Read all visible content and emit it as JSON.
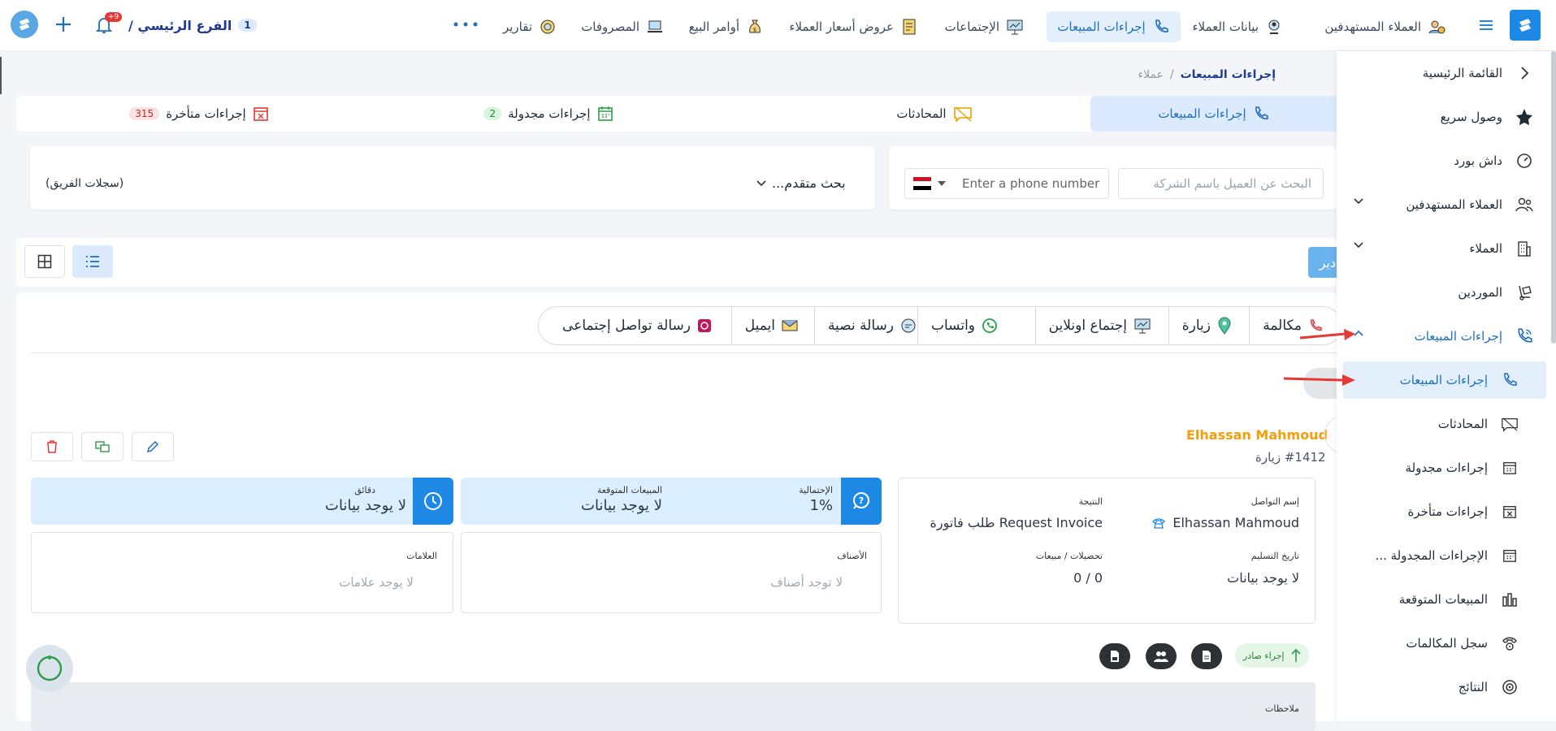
{
  "topbar": {
    "items": [
      {
        "label": "العملاء المستهدفين",
        "icon": "target-customers-icon"
      },
      {
        "label": "بيانات العملاء",
        "icon": "customer-data-icon"
      },
      {
        "label": "إجراءات المبيعات",
        "icon": "phone-icon"
      },
      {
        "label": "الإجتماعات",
        "icon": "presentation-icon"
      },
      {
        "label": "عروض أسعار العملاء",
        "icon": "quote-document-icon"
      },
      {
        "label": "أوامر البيع",
        "icon": "money-bag-icon"
      },
      {
        "label": "المصروفات",
        "icon": "laptop-icon"
      },
      {
        "label": "تقارير",
        "icon": "report-chart-icon"
      }
    ],
    "branch_label": "الفرع الرئيسي /",
    "branch_count": "1",
    "notification_count": "+9"
  },
  "breadcrumb": {
    "parent": "عملاء",
    "separator": "/",
    "current": "إجراءات المبيعات"
  },
  "tabs": [
    {
      "label": "إجراءات المبيعات"
    },
    {
      "label": "المحادثات"
    },
    {
      "label": "إجراءات مجدولة",
      "badge": "2"
    },
    {
      "label": "إجراءات متأخرة",
      "badge": "315"
    }
  ],
  "search": {
    "company_placeholder": "البحث عن العميل باسم الشركة",
    "phone_placeholder": "Enter a phone number",
    "advanced": "بحث متقدم...",
    "team_records": "(سجلات الفريق)"
  },
  "toolbar": {
    "export_partial": "دير"
  },
  "channels": [
    {
      "label": "مكالمة"
    },
    {
      "label": "زيارة"
    },
    {
      "label": "إجتماع اونلاين"
    },
    {
      "label": "واتساب"
    },
    {
      "label": "رسالة نصية"
    },
    {
      "label": "ايميل"
    },
    {
      "label": "رسالة تواصل إجتماعى"
    }
  ],
  "record": {
    "name": "Elhassan Mahmoud",
    "number": "#1412 زيارة",
    "contact_label": "إسم التواصل",
    "contact_value": "Elhassan Mahmoud",
    "result_label": "النتيجة",
    "result_value": "Request Invoice طلب فاتورة",
    "delivery_label": "تاريخ التسليم",
    "delivery_value": "لا يوجد بيانات",
    "collections_label": "تحصيلات / مبيعات",
    "collections_value": "0 / 0",
    "probability_label": "الإحتمالية",
    "probability_value": "1%",
    "expected_label": "المبيعات المتوقعة",
    "expected_value": "لا يوجد بيانات",
    "minutes_label": "دقائق",
    "minutes_value": "لا يوجد بيانات",
    "categories_label": "الأصناف",
    "categories_value": "لا توجد أصناف",
    "tags_label": "العلامات",
    "tags_value": "لا يوجد علامات",
    "direction_badge": "إجراء صادر",
    "notes_label": "ملاحظات"
  },
  "sidebar": {
    "items": [
      {
        "label": "القائمة الرئيسية"
      },
      {
        "label": "وصول سريع"
      },
      {
        "label": "داش بورد"
      },
      {
        "label": "العملاء المستهدفين"
      },
      {
        "label": "العملاء"
      },
      {
        "label": "الموردين"
      },
      {
        "label": "إجراءات المبيعات"
      },
      {
        "label": "إجراءات المبيعات"
      },
      {
        "label": "المحادثات"
      },
      {
        "label": "إجراءات مجدولة"
      },
      {
        "label": "إجراءات متأخرة"
      },
      {
        "label": "الإجراءات المجدولة ..."
      },
      {
        "label": "المبيعات المتوقعة"
      },
      {
        "label": "سجل المكالمات"
      },
      {
        "label": "النتائج"
      }
    ]
  },
  "colors": {
    "accent": "#1e88e5",
    "active_bg": "#e3effb",
    "orange_name": "#f59e0b",
    "arrow_red": "#e53935"
  }
}
